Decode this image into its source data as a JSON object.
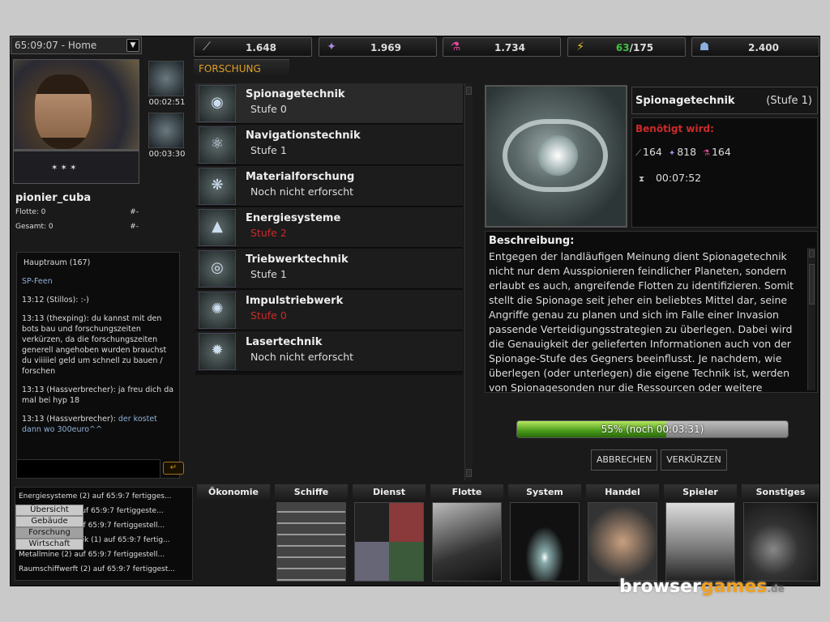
{
  "header": {
    "location": "65:09:07 - Home",
    "resources": [
      {
        "icon": "metal-icon",
        "value": "1.648"
      },
      {
        "icon": "crystal-icon",
        "value": "1.969"
      },
      {
        "icon": "deuterium-icon",
        "value": "1.734"
      },
      {
        "icon": "energy-icon",
        "value": "63",
        "max": "/175",
        "color": "#3fc040"
      },
      {
        "icon": "population-icon",
        "value": "2.400"
      }
    ]
  },
  "player": {
    "name": "pionier_cuba",
    "flotte_label": "Flotte: 0",
    "gesamt_label": "Gesamt: 0",
    "rank": "#-",
    "queue": [
      {
        "time": "00:02:51"
      },
      {
        "time": "00:03:30"
      }
    ]
  },
  "chat": {
    "channel": "Hauptraum (167)",
    "messages": [
      {
        "text": "SP-Feen",
        "style": "blue"
      },
      {
        "time": "13:12",
        "user": "(Stillos):",
        "text": ":-)",
        "style": "wht"
      },
      {
        "time": "13:13",
        "user": "(thexping):",
        "text": "du kannst mit den bots bau und forschungszeiten verkürzen, da die forschungszeiten generell angehoben wurden brauchst du viiiiiel geld um schnell zu bauen / forschen",
        "style": "wht"
      },
      {
        "time": "13:13",
        "user": "(Hassverbrecher):",
        "text": "ja freu dich da mal bei hyp 18",
        "style": "wht"
      },
      {
        "time": "13:13",
        "user": "(Hassverbrecher):",
        "text": "der kostet dann wo 300euro^^",
        "style": "blue"
      }
    ],
    "send_label": "↵"
  },
  "log": [
    "Energiesysteme (2) auf 65:9:7 fertigges...",
    "Kristallmine (2) auf 65:9:7 fertiggeste...",
    "Metallmine (3) auf 65:9:7 fertiggestell...",
    "Navigationstechnik (1) auf 65:9:7 fertig...",
    "Metallmine (2) auf 65:9:7 fertiggestell...",
    "Raumschiffwerft (2) auf 65:9:7 fertiggest..."
  ],
  "tab": {
    "label": "FORSCHUNG"
  },
  "research": [
    {
      "name": "Spionagetechnik",
      "status": "Stufe 0",
      "red": false,
      "icon": "eye-icon",
      "glyph": "◉"
    },
    {
      "name": "Navigationstechnik",
      "status": "Stufe 1",
      "red": false,
      "icon": "atom-icon",
      "glyph": "⚛"
    },
    {
      "name": "Materialforschung",
      "status": "Noch nicht erforscht",
      "red": false,
      "icon": "lattice-icon",
      "glyph": "❋"
    },
    {
      "name": "Energiesysteme",
      "status": "Stufe 2",
      "red": true,
      "icon": "graph-icon",
      "glyph": "▲"
    },
    {
      "name": "Triebwerktechnik",
      "status": "Stufe 1",
      "red": false,
      "icon": "engine-icon",
      "glyph": "◎"
    },
    {
      "name": "Impulstriebwerk",
      "status": "Stufe 0",
      "red": true,
      "icon": "impulse-icon",
      "glyph": "✺"
    },
    {
      "name": "Lasertechnik",
      "status": "Noch nicht erforscht",
      "red": false,
      "icon": "laser-icon",
      "glyph": "✹"
    }
  ],
  "detail": {
    "title": "Spionagetechnik",
    "level": "(Stufe 1)",
    "req_label": "Benötigt wird:",
    "cost": {
      "metal": "164",
      "crystal": "818",
      "deuterium": "164"
    },
    "time": "00:07:52",
    "desc_label": "Beschreibung:",
    "desc": "Entgegen der landläufigen Meinung dient Spionagetechnik nicht nur dem Ausspionieren feindlicher Planeten, sondern erlaubt es auch, angreifende Flotten zu identifizieren. Somit stellt die Spionage seit jeher ein beliebtes Mittel dar, seine Angriffe genau zu planen und sich im Falle einer Invasion passende Verteidigungsstrategien zu überlegen. Dabei wird die Genauigkeit der gelieferten Informationen auch von der Spionage-Stufe des Gegners beeinflusst. Je nachdem, wie überlegen (oder unterlegen) die eigene Technik ist, werden von Spionagesonden nur die Ressourcen oder weitere",
    "progress": 55,
    "progress_label": "55% (noch 00:03:31)",
    "cancel_label": "ABBRECHEN",
    "shorten_label": "VERKÜRZEN"
  },
  "menu": [
    {
      "label": "Ökonomie",
      "icon": "economy-icon"
    },
    {
      "label": "Schiffe",
      "icon": "ships-icon"
    },
    {
      "label": "Dienst",
      "icon": "service-icon"
    },
    {
      "label": "Flotte",
      "icon": "fleet-icon"
    },
    {
      "label": "System",
      "icon": "system-icon"
    },
    {
      "label": "Handel",
      "icon": "trade-icon"
    },
    {
      "label": "Spieler",
      "icon": "player-icon"
    },
    {
      "label": "Sonstiges",
      "icon": "misc-icon"
    }
  ],
  "submenu": [
    "Übersicht",
    "Gebäude",
    "Forschung",
    "Wirtschaft"
  ],
  "watermark": {
    "a": "browser",
    "b": "games",
    "c": ".de"
  }
}
